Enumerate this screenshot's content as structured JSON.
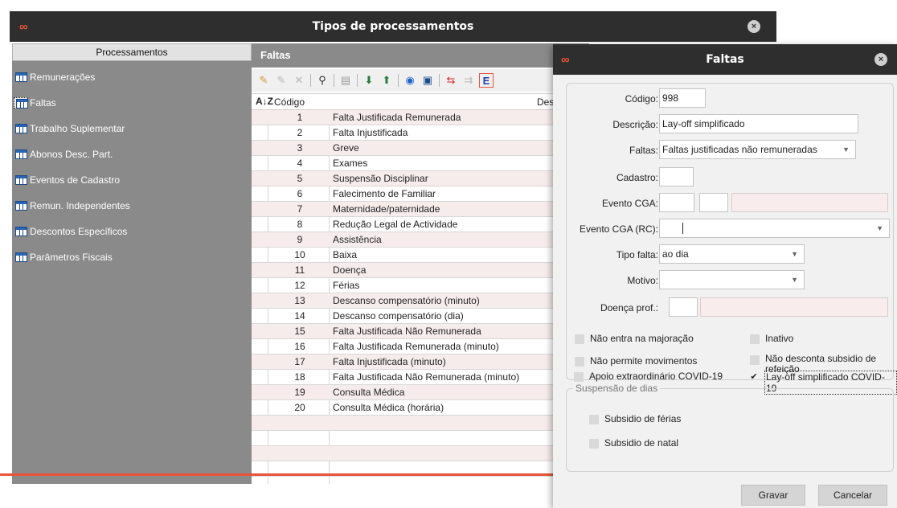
{
  "main_window": {
    "title": "Tipos de processamentos",
    "logo": "∞",
    "close": "×"
  },
  "sidebar": {
    "header": "Processamentos",
    "items": [
      {
        "label": "Remunerações"
      },
      {
        "label": "Faltas"
      },
      {
        "label": "Trabalho Suplementar"
      },
      {
        "label": "Abonos Desc. Part."
      },
      {
        "label": "Eventos de Cadastro"
      },
      {
        "label": "Remun. Independentes"
      },
      {
        "label": "Descontos Específicos"
      },
      {
        "label": "Parâmetros Fiscais"
      }
    ]
  },
  "faltas_panel": {
    "header": "Faltas",
    "toolbar_last": "E",
    "columns": {
      "code": "Código",
      "desc": "Desc"
    },
    "sort_icon": "A↓Z",
    "rows": [
      {
        "code": "1",
        "desc": "Falta Justificada Remunerada"
      },
      {
        "code": "2",
        "desc": "Falta Injustificada"
      },
      {
        "code": "3",
        "desc": "Greve"
      },
      {
        "code": "4",
        "desc": "Exames"
      },
      {
        "code": "5",
        "desc": "Suspensão Disciplinar"
      },
      {
        "code": "6",
        "desc": "Falecimento de Familiar"
      },
      {
        "code": "7",
        "desc": "Maternidade/paternidade"
      },
      {
        "code": "8",
        "desc": "Redução Legal de Actividade"
      },
      {
        "code": "9",
        "desc": "Assistência"
      },
      {
        "code": "10",
        "desc": "Baixa"
      },
      {
        "code": "11",
        "desc": "Doença"
      },
      {
        "code": "12",
        "desc": "Férias"
      },
      {
        "code": "13",
        "desc": "Descanso compensatório (minuto)"
      },
      {
        "code": "14",
        "desc": "Descanso compensatório (dia)"
      },
      {
        "code": "15",
        "desc": "Falta Justificada Não Remunerada"
      },
      {
        "code": "16",
        "desc": "Falta Justificada Remunerada (minuto)"
      },
      {
        "code": "17",
        "desc": "Falta Injustificada (minuto)"
      },
      {
        "code": "18",
        "desc": "Falta Justificada Não Remunerada (minuto)"
      },
      {
        "code": "19",
        "desc": "Consulta Médica"
      },
      {
        "code": "20",
        "desc": "Consulta Médica (horária)"
      }
    ]
  },
  "dialog": {
    "title": "Faltas",
    "logo": "∞",
    "close": "×",
    "codigo_label": "Código:",
    "codigo_value": "998",
    "descricao_label": "Descrição:",
    "descricao_value": "Lay-off simplificado",
    "faltas_label": "Faltas:",
    "faltas_value": "Faltas justificadas não remuneradas",
    "cadastro_label": "Cadastro:",
    "evento_cga_label": "Evento CGA:",
    "evento_cga_rc_label": "Evento CGA (RC):",
    "tipo_falta_label": "Tipo falta:",
    "tipo_falta_value": "ao dia",
    "motivo_label": "Motivo:",
    "doenca_prof_label": "Doença prof.:",
    "checks": {
      "nao_majoracao": "Não entra na majoração",
      "inativo": "Inativo",
      "nao_movimentos": "Não permite movimentos",
      "nao_desconta_1": "Não desconta subsidio de",
      "nao_desconta_2": "refeição",
      "apoio_covid": "Apoio extraordinário COVID-19",
      "layoff_covid": "Lay-off simplificado COVID-19"
    },
    "suspensao_legend": "Suspensão de dias",
    "subsidio_ferias": "Subsidio de férias",
    "subsidio_natal": "Subsidio de natal",
    "gravar": "Gravar",
    "cancelar": "Cancelar"
  },
  "colors": {
    "titlebar": "#2e2e2e",
    "accent": "#e8533a",
    "sidebar_bg": "#8a8a8a",
    "row_alt": "#f7ecec"
  }
}
